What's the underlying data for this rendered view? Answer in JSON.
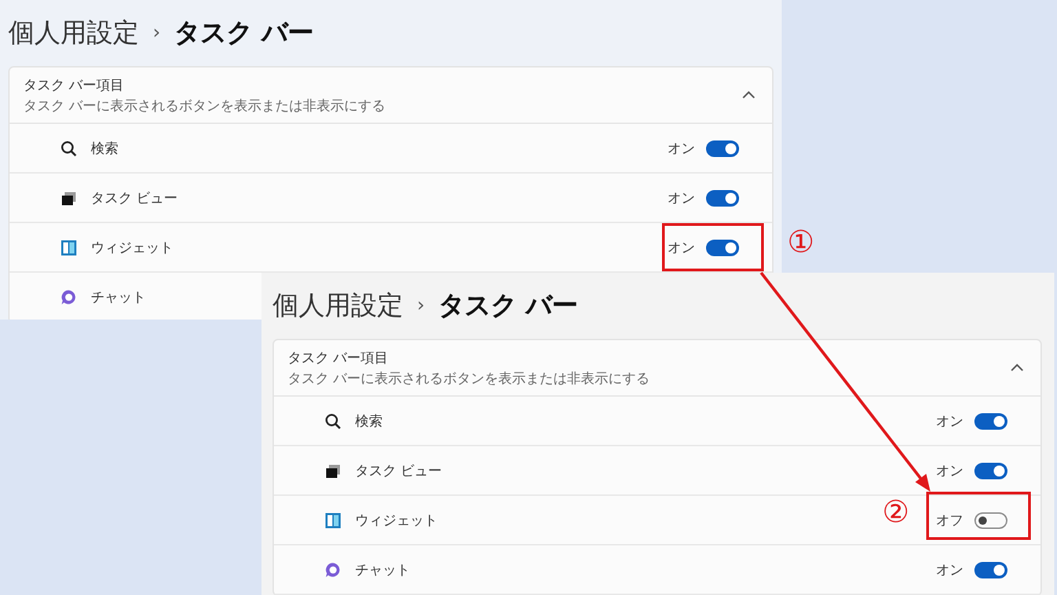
{
  "panels": [
    {
      "breadcrumb_parent": "個人用設定",
      "breadcrumb_separator": "›",
      "breadcrumb_current": "タスク バー",
      "section": {
        "title": "タスク バー項目",
        "subtitle": "タスク バーに表示されるボタンを表示または非表示にする",
        "expanded": true
      },
      "items": [
        {
          "kind": "search",
          "label": "検索",
          "state_label": "オン",
          "on": true
        },
        {
          "kind": "task-view",
          "label": "タスク ビュー",
          "state_label": "オン",
          "on": true
        },
        {
          "kind": "widgets",
          "label": "ウィジェット",
          "state_label": "オン",
          "on": true
        },
        {
          "kind": "chat",
          "label": "チャット"
        }
      ]
    },
    {
      "breadcrumb_parent": "個人用設定",
      "breadcrumb_separator": "›",
      "breadcrumb_current": "タスク バー",
      "section": {
        "title": "タスク バー項目",
        "subtitle": "タスク バーに表示されるボタンを表示または非表示にする",
        "expanded": true
      },
      "items": [
        {
          "kind": "search",
          "label": "検索",
          "state_label": "オン",
          "on": true
        },
        {
          "kind": "task-view",
          "label": "タスク ビュー",
          "state_label": "オン",
          "on": true
        },
        {
          "kind": "widgets",
          "label": "ウィジェット",
          "state_label": "オフ",
          "on": false
        },
        {
          "kind": "chat",
          "label": "チャット",
          "state_label": "オン",
          "on": true
        }
      ]
    }
  ],
  "annotations": [
    {
      "label": "①"
    },
    {
      "label": "②"
    }
  ]
}
